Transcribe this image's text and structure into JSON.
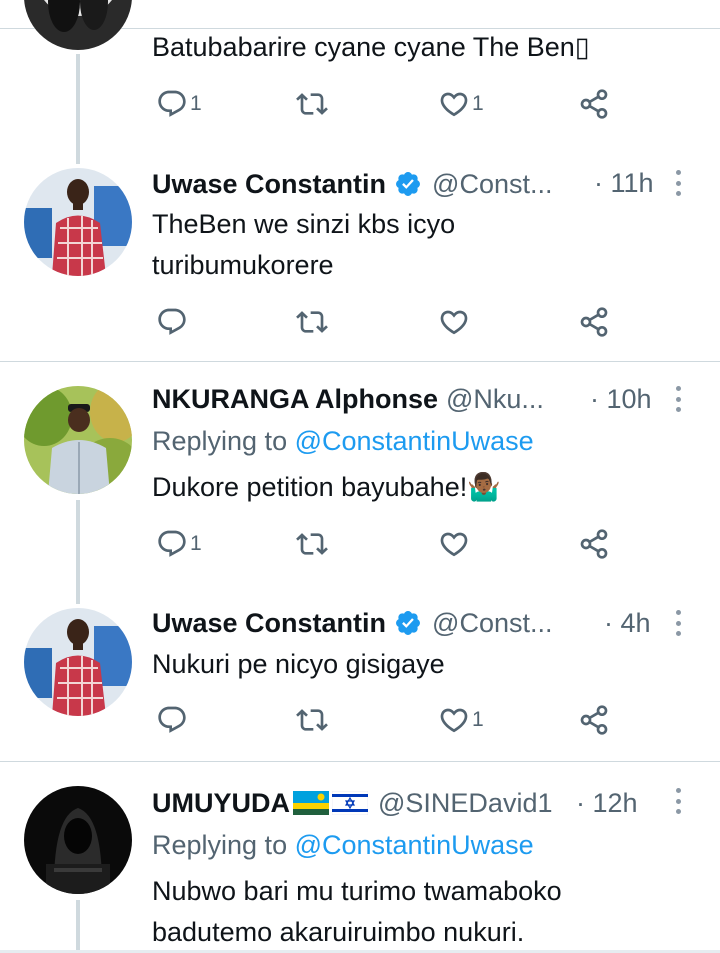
{
  "tweets": [
    {
      "text": "Batubabarire cyane cyane The Ben▯",
      "actions": {
        "reply": "1",
        "retweet": "",
        "like": "1"
      }
    },
    {
      "name": "Uwase Constantin",
      "handle": "@Const...",
      "time": "· 11h",
      "text_lines": [
        "TheBen we sinzi kbs icyo",
        "turibumukorere"
      ],
      "actions": {
        "reply": "",
        "retweet": "",
        "like": ""
      }
    },
    {
      "name": "NKURANGA Alphonse",
      "handle": "@Nku...",
      "time": "· 10h",
      "replying_prefix": "Replying to ",
      "replying_user": "@ConstantinUwase",
      "text": "Dukore petition bayubahe!🤷🏾‍♂️",
      "actions": {
        "reply": "1",
        "retweet": "",
        "like": ""
      }
    },
    {
      "name": "Uwase Constantin",
      "handle": "@Const...",
      "time": "· 4h",
      "text": "Nukuri pe nicyo gisigaye",
      "actions": {
        "reply": "",
        "retweet": "",
        "like": "1"
      }
    },
    {
      "name": "UMUYUDA",
      "handle": "@SINEDavid1",
      "time": "· 12h",
      "replying_prefix": "Replying to ",
      "replying_user": "@ConstantinUwase",
      "text_lines": [
        "Nubwo bari mu turimo twamaboko",
        "badutemo akaruiruimbo nukuri."
      ]
    }
  ],
  "colors": {
    "accent": "#1d9bf0",
    "secondary_text": "#536471",
    "divider": "#cfd9de"
  },
  "icons": [
    "reply-icon",
    "retweet-icon",
    "like-icon",
    "share-icon",
    "verified-badge-icon",
    "more-icon"
  ]
}
